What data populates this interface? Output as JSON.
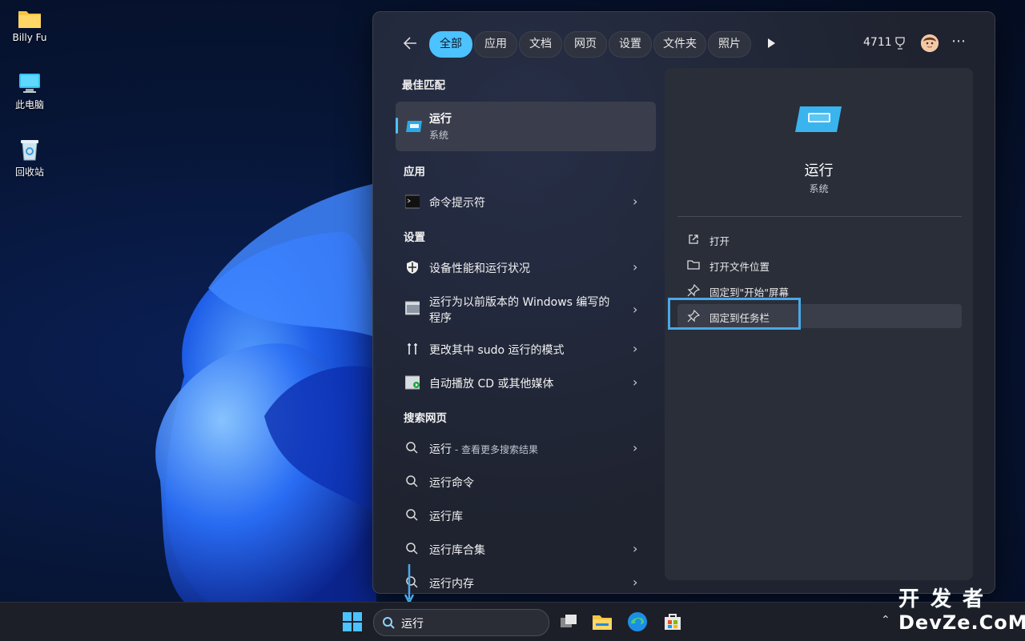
{
  "desktop": {
    "icons": [
      {
        "label": "Billy Fu",
        "icon": "folder-icon"
      },
      {
        "label": "此电脑",
        "icon": "computer-icon"
      },
      {
        "label": "回收站",
        "icon": "recycle-bin-icon"
      }
    ]
  },
  "search_panel": {
    "tabs": [
      {
        "label": "全部",
        "active": true
      },
      {
        "label": "应用",
        "active": false
      },
      {
        "label": "文档",
        "active": false
      },
      {
        "label": "网页",
        "active": false
      },
      {
        "label": "设置",
        "active": false
      },
      {
        "label": "文件夹",
        "active": false
      },
      {
        "label": "照片",
        "active": false
      }
    ],
    "points": "4711",
    "sections": {
      "best_match": "最佳匹配",
      "apps": "应用",
      "settings": "设置",
      "web": "搜索网页"
    },
    "best_match": {
      "title": "运行",
      "subtitle": "系统"
    },
    "apps": [
      {
        "label": "命令提示符",
        "icon": "command-prompt-icon"
      }
    ],
    "settings": [
      {
        "label": "设备性能和运行状况",
        "icon": "shield-icon"
      },
      {
        "label": "运行为以前版本的 Windows 编写的程序",
        "icon": "compatibility-icon"
      },
      {
        "label": "更改其中 sudo 运行的模式",
        "icon": "tools-icon"
      },
      {
        "label": "自动播放 CD 或其他媒体",
        "icon": "autoplay-icon"
      }
    ],
    "web": [
      {
        "label": "运行",
        "suffix": " - 查看更多搜索结果"
      },
      {
        "label": "运行命令"
      },
      {
        "label": "运行库"
      },
      {
        "label": "运行库合集"
      },
      {
        "label": "运行内存"
      }
    ],
    "detail": {
      "title": "运行",
      "subtitle": "系统",
      "actions": [
        {
          "label": "打开",
          "icon": "open-external-icon"
        },
        {
          "label": "打开文件位置",
          "icon": "folder-open-icon"
        },
        {
          "label": "固定到\"开始\"屏幕",
          "icon": "pin-icon"
        },
        {
          "label": "固定到任务栏",
          "icon": "pin-icon"
        }
      ]
    }
  },
  "taskbar": {
    "search_value": "运行"
  },
  "watermark": {
    "line1": "开发者",
    "line2": "DevZe.CoM"
  },
  "colors": {
    "accent": "#4cc2ff",
    "highlight_box": "#4aa8e8"
  }
}
